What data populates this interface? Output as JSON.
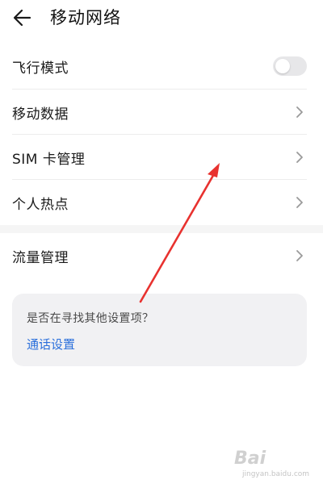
{
  "header": {
    "title": "移动网络",
    "back_icon": "arrow-left-icon"
  },
  "settings": {
    "airplane_mode": {
      "label": "飞行模式",
      "enabled": false
    },
    "items": [
      {
        "label": "移动数据"
      },
      {
        "label": "SIM 卡管理"
      },
      {
        "label": "个人热点"
      }
    ],
    "traffic": {
      "label": "流量管理"
    }
  },
  "suggestion": {
    "question": "是否在寻找其他设置项？",
    "link": "通话设置"
  },
  "watermark": {
    "brand": "Bai",
    "sub": "jingyan.baidu.com"
  },
  "colors": {
    "link": "#2a6fdb",
    "arrow": "#e8322f",
    "card_bg": "#f1f1f3",
    "toggle_off": "#e7e7e9"
  }
}
